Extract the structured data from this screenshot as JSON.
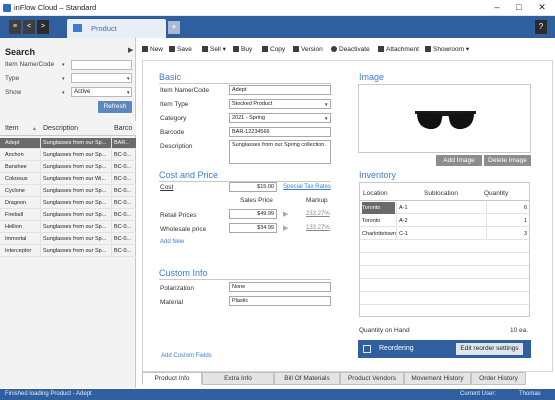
{
  "window": {
    "title": "inFlow Cloud – Standard",
    "controls": {
      "minimize": "–",
      "maximize": "□",
      "close": "✕"
    }
  },
  "tabs": {
    "back": "<",
    "forward": ">",
    "menu": "≡",
    "active_tab": "Product",
    "add": "+",
    "help": "?"
  },
  "search": {
    "title": "Search",
    "collapse": "▶",
    "fields": [
      {
        "label": "Item Name/Code",
        "value": ""
      },
      {
        "label": "Type",
        "value": ""
      },
      {
        "label": "Show",
        "value": "Active"
      }
    ],
    "refresh_label": "Refresh"
  },
  "item_list": {
    "columns": [
      "Item",
      "Description",
      "Barco"
    ],
    "sort_icon": "▲",
    "rows": [
      {
        "item": "Adept",
        "description": "Sunglasses from our Sp...",
        "barcode": "BAR...",
        "selected": true
      },
      {
        "item": "Anchon",
        "description": "Sunglasses from our Sp...",
        "barcode": "BC-0..."
      },
      {
        "item": "Banshee",
        "description": "Sunglasses from our Sp...",
        "barcode": "BC-0..."
      },
      {
        "item": "Colossus",
        "description": "Sunglasses from our Wi...",
        "barcode": "BC-0..."
      },
      {
        "item": "Cyclone",
        "description": "Sunglasses from our Sp...",
        "barcode": "BC-0..."
      },
      {
        "item": "Dragoon",
        "description": "Sunglasses from our Sp...",
        "barcode": "BC-0..."
      },
      {
        "item": "Fireball",
        "description": "Sunglasses from our Sp...",
        "barcode": "BC-0..."
      },
      {
        "item": "Hellion",
        "description": "Sunglasses from our Sp...",
        "barcode": "BC-0..."
      },
      {
        "item": "Immortal",
        "description": "Sunglasses from our Sp...",
        "barcode": "BC-0..."
      },
      {
        "item": "Interceptor",
        "description": "Sunglasses from our Sp...",
        "barcode": "BC-0..."
      }
    ]
  },
  "toolbar": {
    "new": "New",
    "save": "Save",
    "sell": "Sell",
    "buy": "Buy",
    "copy": "Copy",
    "version": "Version",
    "deactivate": "Deactivate",
    "attachment": "Attachment",
    "showroom": "Showroom",
    "dropdown": "▾"
  },
  "basic": {
    "title": "Basic",
    "fields": [
      {
        "label": "Item Name/Code",
        "value": "Adept"
      },
      {
        "label": "Item Type",
        "value": "Stocked Product"
      },
      {
        "label": "Category",
        "value": "2021 - Spring"
      },
      {
        "label": "Barcode",
        "value": "BAR-12234566"
      },
      {
        "label": "Description",
        "value": "Sunglasses from our Spring collection."
      }
    ]
  },
  "cost_price": {
    "title": "Cost and Price",
    "cost_label": "Cost",
    "cost_value": "$15.00",
    "special_tax": "Special Tax Rates",
    "sales_price_header": "Sales Price",
    "markup_header": "Markup",
    "rows": [
      {
        "label": "Retail Prices",
        "price": "$49.99",
        "markup": "233.27%"
      },
      {
        "label": "Wholesale price",
        "price": "$34.99",
        "markup": "133.27%"
      }
    ],
    "arrow": "▶",
    "add_new": "Add New"
  },
  "custom_info": {
    "title": "Custom Info",
    "fields": [
      {
        "label": "Polarization",
        "value": "None"
      },
      {
        "label": "Material",
        "value": "Plastic"
      }
    ],
    "add_custom_fields": "Add Custom Fields"
  },
  "image": {
    "title": "Image",
    "add_label": "Add Image",
    "delete_label": "Delete Image"
  },
  "inventory": {
    "title": "Inventory",
    "columns": [
      "Location",
      "Sublocation",
      "Quantity"
    ],
    "rows": [
      {
        "location": "Toronto",
        "sublocation": "A-1",
        "quantity": "6",
        "selected": true
      },
      {
        "location": "Toronto",
        "sublocation": "A-2",
        "quantity": "1"
      },
      {
        "location": "Charlottetown",
        "sublocation": "C-1",
        "quantity": "3"
      }
    ],
    "qty_on_hand_label": "Quantity on Hand",
    "qty_on_hand_value": "10 ea.",
    "reordering_label": "Reordering",
    "edit_reorder_label": "Edit reorder settings"
  },
  "bottom_tabs": [
    "Product Info",
    "Extra Info",
    "Bill Of Materials",
    "Product Vendors",
    "Movement History",
    "Order History"
  ],
  "status": {
    "message": "Finished loading Product - Adept",
    "current_user_label": "Current User:",
    "current_user": "Thomas"
  },
  "colors": {
    "accent": "#2f5f9f",
    "link": "#3f7bd1",
    "selected_row": "#6a6a6a"
  }
}
